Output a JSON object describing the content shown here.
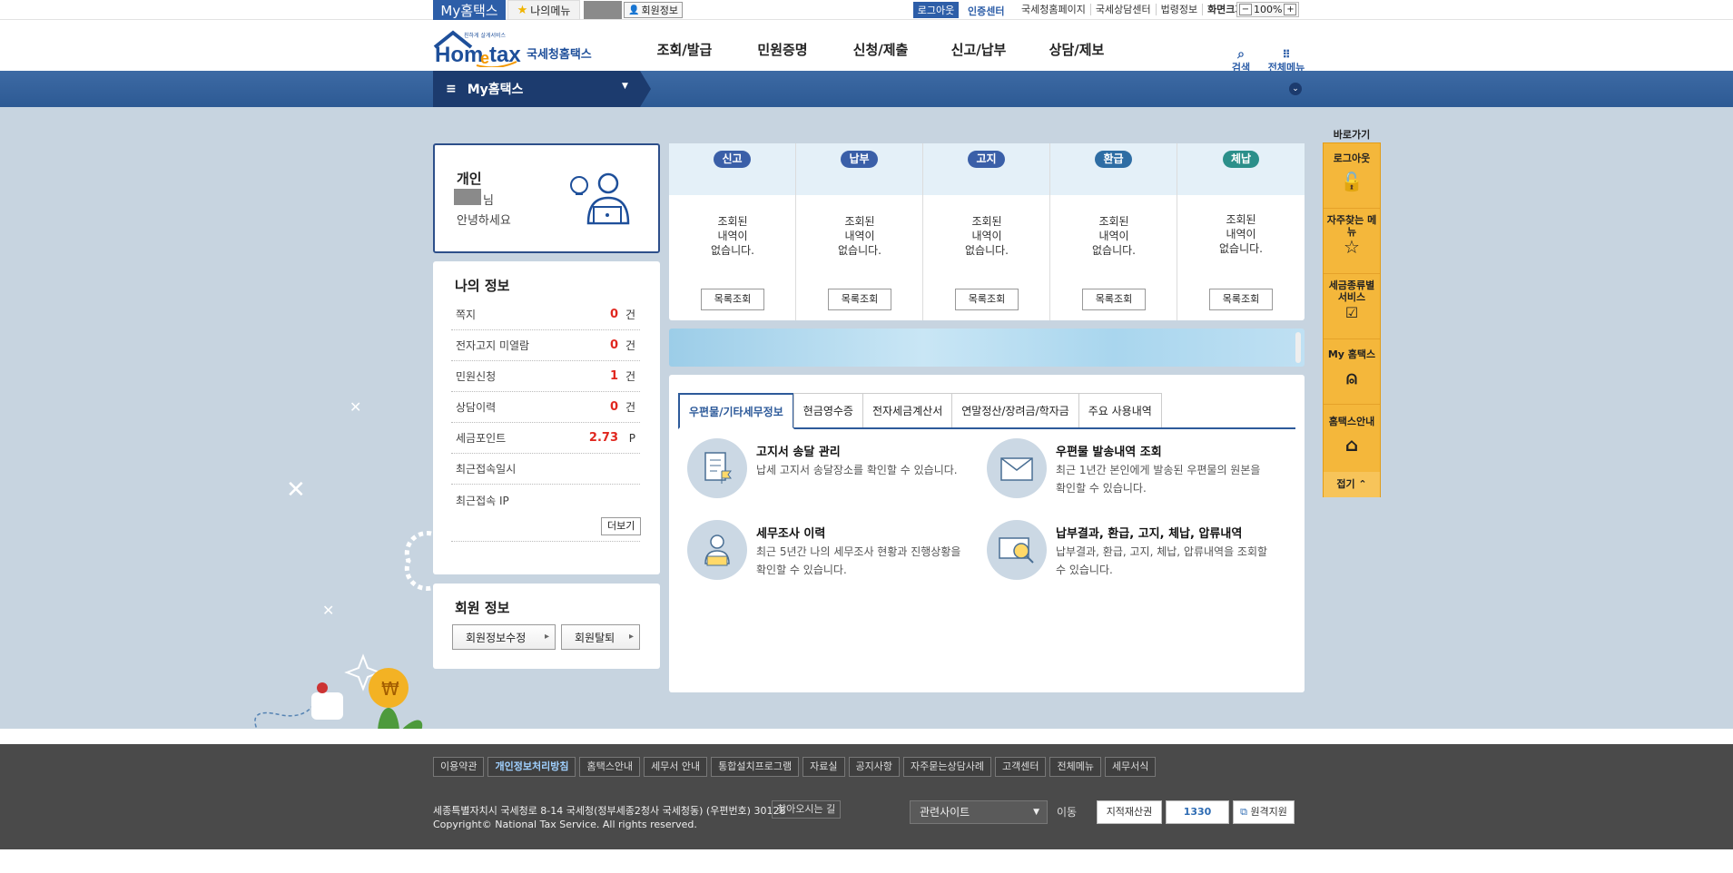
{
  "topbar": {
    "my_hometax": "My홈택스",
    "my_menu": "나의메뉴",
    "member_info": "회원정보",
    "logout": "로그아웃",
    "cert_center": "인증센터",
    "links": [
      "국세청홈페이지",
      "국세상담센터",
      "법령정보",
      "화면크기"
    ],
    "zoom_minus": "−",
    "zoom_value": "100%",
    "zoom_plus": "+"
  },
  "header": {
    "logo_tagline": "친하게 살게서비스",
    "logo_main": "Hometax",
    "logo_sub": "국세청홈택스",
    "nav": [
      "조회/발급",
      "민원증명",
      "신청/제출",
      "신고/납부",
      "상담/제보"
    ],
    "search": "검색",
    "all_menu": "전체메뉴"
  },
  "subbar": {
    "title": "My홈택스"
  },
  "profile": {
    "type": "개인",
    "suffix": "님",
    "greeting": "안녕하세요"
  },
  "my_info": {
    "title": "나의 정보",
    "rows": [
      {
        "label": "쪽지",
        "value": "0",
        "unit": "건"
      },
      {
        "label": "전자고지 미열람",
        "value": "0",
        "unit": "건"
      },
      {
        "label": "민원신청",
        "value": "1",
        "unit": "건"
      },
      {
        "label": "상담이력",
        "value": "0",
        "unit": "건"
      },
      {
        "label": "세금포인트",
        "value": "2.73",
        "unit": "P"
      },
      {
        "label": "최근접속일시",
        "value": "",
        "unit": ""
      },
      {
        "label": "최근접속 IP",
        "value": "",
        "unit": ""
      }
    ],
    "more": "더보기"
  },
  "member": {
    "title": "회원 정보",
    "edit": "회원정보수정",
    "withdraw": "회원탈퇴"
  },
  "status": {
    "columns": [
      {
        "label": "신고",
        "color": "#3a5fa8",
        "lines": [
          "조회된",
          "내역이",
          "없습니다."
        ],
        "button": "목록조회"
      },
      {
        "label": "납부",
        "color": "#3a5fa8",
        "lines": [
          "조회된",
          "내역이",
          "없습니다."
        ],
        "button": "목록조회"
      },
      {
        "label": "고지",
        "color": "#3a5fa8",
        "lines": [
          "조회된",
          "내역이",
          "없습니다."
        ],
        "button": "목록조회"
      },
      {
        "label": "환급",
        "color": "#2e6da4",
        "lines": [
          "조회된",
          "내역이",
          "없습니다."
        ],
        "button": "목록조회"
      },
      {
        "label": "체납",
        "color": "#2b8f8a",
        "lines": [
          "조회된",
          "내역이",
          "없습니다."
        ],
        "button": "목록조회"
      }
    ]
  },
  "tabs": {
    "items": [
      "우편물/기타세무정보",
      "현금영수증",
      "전자세금계산서",
      "연말정산/장려금/학자금",
      "주요 사용내역"
    ],
    "active": "우편물/기타세무정보"
  },
  "services": [
    {
      "title": "고지서 송달 관리",
      "desc": "납세 고지서 송달장소를 확인할 수 있습니다.",
      "icon": "document-flag-icon"
    },
    {
      "title": "우편물 발송내역 조회",
      "desc": "최근 1년간 본인에게 발송된 우편물의 원본을 확인할 수 있습니다.",
      "icon": "envelope-icon"
    },
    {
      "title": "세무조사 이력",
      "desc": "최근 5년간 나의 세무조사 현황과 진행상황을 확인할 수 있습니다.",
      "icon": "person-laptop-icon"
    },
    {
      "title": "납부결과, 환급, 고지, 체납, 압류내역",
      "desc": "납부결과, 환급, 고지, 체납, 압류내역을 조회할 수 있습니다.",
      "icon": "monitor-search-icon"
    }
  ],
  "quick": {
    "title": "바로가기",
    "items": [
      "로그아웃",
      "자주찾는 메뉴",
      "세금종류별 서비스",
      "My 홈택스",
      "홈택스안내"
    ],
    "fold": "접기"
  },
  "footer": {
    "links": [
      "이용약관",
      "개인정보처리방침",
      "홈택스안내",
      "세무서 안내",
      "통합설치프로그램",
      "자료실",
      "공지사항",
      "자주묻는상담사례",
      "고객센터",
      "전체메뉴",
      "세무서식"
    ],
    "address": "세종특별자치시 국세청로 8-14 국세청(정부세종2청사 국세청동) (우편번호) 30128",
    "directions": "찾아오시는 길",
    "copyright": "Copyright© National Tax Service. All rights reserved.",
    "related_site": "관련사이트",
    "go": "이동",
    "badges": [
      "지적재산권",
      "1330",
      "원격지원"
    ]
  }
}
